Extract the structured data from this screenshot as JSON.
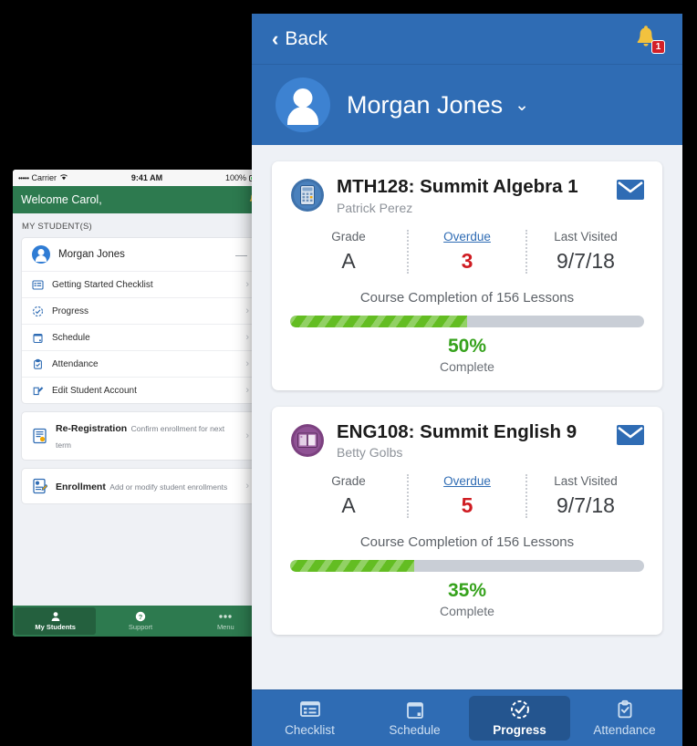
{
  "background_phone": {
    "status_bar": {
      "signal": "•••••",
      "carrier": "Carrier",
      "wifi_icon": "wifi-icon",
      "time": "9:41 AM",
      "battery_pct": "100%",
      "battery_icon": "battery-full-icon"
    },
    "header": {
      "title": "Welcome Carol,",
      "bell_icon": "bell-icon"
    },
    "section_label": "MY STUDENT(S)",
    "student": {
      "name": "Morgan Jones",
      "collapse_glyph": "—",
      "avatar_icon": "person-avatar-icon"
    },
    "menu_items": [
      {
        "label": "Getting Started Checklist",
        "icon": "checklist-icon",
        "chevron": "›"
      },
      {
        "label": "Progress",
        "icon": "progress-clock-icon",
        "chevron": "›"
      },
      {
        "label": "Schedule",
        "icon": "calendar-icon",
        "chevron": "›"
      },
      {
        "label": "Attendance",
        "icon": "clipboard-check-icon",
        "chevron": "›"
      },
      {
        "label": "Edit Student Account",
        "icon": "edit-pencil-icon",
        "chevron": "›"
      }
    ],
    "action_items": [
      {
        "title": "Re-Registration",
        "subtitle": "Confirm enrollment for next term",
        "icon": "document-gear-icon",
        "chevron": "›"
      },
      {
        "title": "Enrollment",
        "subtitle": "Add or modify student enrollments",
        "icon": "enrollment-form-icon",
        "chevron": "›"
      }
    ],
    "tabs": [
      {
        "label": "My Students",
        "icon": "person-icon",
        "active": true
      },
      {
        "label": "Support",
        "icon": "question-circle-icon",
        "active": false
      },
      {
        "label": "Menu",
        "icon": "ellipsis-icon",
        "active": false
      }
    ]
  },
  "panel": {
    "nav": {
      "back_label": "Back",
      "back_icon": "chevron-left-icon",
      "bell_icon": "bell-icon",
      "notification_count": "1"
    },
    "student_header": {
      "name": "Morgan Jones",
      "caret": "⌄",
      "avatar_icon": "person-avatar-icon"
    },
    "courses": [
      {
        "code_title": "MTH128: Summit Algebra 1",
        "teacher": "Patrick Perez",
        "icon": "calculator-icon",
        "icon_color": "#2f6cb4",
        "mail_icon": "envelope-icon",
        "stats": [
          {
            "label": "Grade",
            "value": "A",
            "alert": false,
            "link": false
          },
          {
            "label": "Overdue",
            "value": "3",
            "alert": true,
            "link": true
          },
          {
            "label": "Last Visited",
            "value": "9/7/18",
            "alert": false,
            "link": false
          }
        ],
        "completion_label": "Course Completion of 156 Lessons",
        "percent": 50,
        "percent_text": "50%",
        "percent_sub": "Complete"
      },
      {
        "code_title": "ENG108: Summit English 9",
        "teacher": "Betty Golbs",
        "icon": "open-book-icon",
        "icon_color": "#8a4d8f",
        "mail_icon": "envelope-icon",
        "stats": [
          {
            "label": "Grade",
            "value": "A",
            "alert": false,
            "link": false
          },
          {
            "label": "Overdue",
            "value": "5",
            "alert": true,
            "link": true
          },
          {
            "label": "Last Visited",
            "value": "9/7/18",
            "alert": false,
            "link": false
          }
        ],
        "completion_label": "Course Completion of 156 Lessons",
        "percent": 35,
        "percent_text": "35%",
        "percent_sub": "Complete"
      }
    ],
    "tabs": [
      {
        "label": "Checklist",
        "icon": "checklist-icon",
        "active": false
      },
      {
        "label": "Schedule",
        "icon": "calendar-icon",
        "active": false
      },
      {
        "label": "Progress",
        "icon": "progress-clock-icon",
        "active": true
      },
      {
        "label": "Attendance",
        "icon": "clipboard-check-icon",
        "active": false
      }
    ]
  },
  "colors": {
    "panel_accent": "#2f6cb4",
    "panel_accent_dark": "#24558f",
    "phone_accent": "#2d7a4f",
    "progress_green": "#63bd22",
    "percent_green": "#36a21c",
    "alert_red": "#cf1c22",
    "card_bg": "#ffffff",
    "page_bg": "#eef1f6"
  }
}
